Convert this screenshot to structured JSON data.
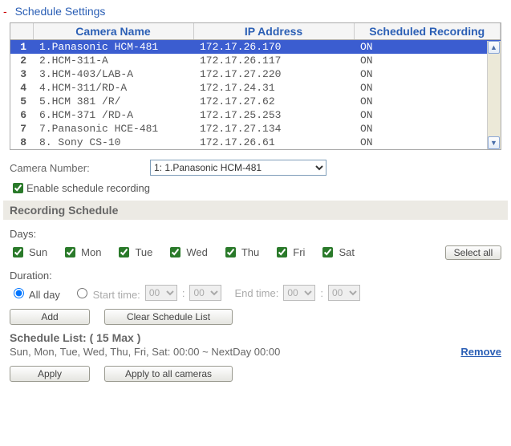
{
  "header": {
    "title": "Schedule Settings"
  },
  "table": {
    "columns": {
      "idx": "",
      "name": "Camera Name",
      "ip": "IP Address",
      "rec": "Scheduled Recording"
    },
    "rows": [
      {
        "idx": "1",
        "name": "1.Panasonic HCM-481",
        "ip": "172.17.26.170",
        "rec": "ON",
        "selected": true
      },
      {
        "idx": "2",
        "name": "2.HCM-311-A",
        "ip": "172.17.26.117",
        "rec": "ON"
      },
      {
        "idx": "3",
        "name": "3.HCM-403/LAB-A",
        "ip": "172.17.27.220",
        "rec": "ON"
      },
      {
        "idx": "4",
        "name": "4.HCM-311/RD-A",
        "ip": "172.17.24.31",
        "rec": "ON"
      },
      {
        "idx": "5",
        "name": "5.HCM 381 /R/",
        "ip": "172.17.27.62",
        "rec": "ON"
      },
      {
        "idx": "6",
        "name": "6.HCM-371 /RD-A",
        "ip": "172.17.25.253",
        "rec": "ON"
      },
      {
        "idx": "7",
        "name": "7.Panasonic HCE-481",
        "ip": "172.17.27.134",
        "rec": "ON"
      },
      {
        "idx": "8",
        "name": "8. Sony CS-10",
        "ip": "172.17.26.61",
        "rec": "ON"
      }
    ]
  },
  "camera_select": {
    "label": "Camera Number:",
    "value": "1: 1.Panasonic HCM-481"
  },
  "enable": {
    "checked": true,
    "label": "Enable schedule recording"
  },
  "recording_section": "Recording Schedule",
  "days": {
    "label": "Days:",
    "items": [
      {
        "label": "Sun",
        "checked": true
      },
      {
        "label": "Mon",
        "checked": true
      },
      {
        "label": "Tue",
        "checked": true
      },
      {
        "label": "Wed",
        "checked": true
      },
      {
        "label": "Thu",
        "checked": true
      },
      {
        "label": "Fri",
        "checked": true
      },
      {
        "label": "Sat",
        "checked": true
      }
    ],
    "select_all": "Select all"
  },
  "duration": {
    "label": "Duration:",
    "allday": "All day",
    "start": "Start time:",
    "end": "End time:",
    "hh": "00",
    "mm": "00",
    "mode": "allday"
  },
  "buttons": {
    "add": "Add",
    "clear": "Clear Schedule List",
    "apply": "Apply",
    "apply_all": "Apply to all cameras"
  },
  "schedule_list": {
    "title": "Schedule List: ( 15 Max )",
    "entry": "Sun, Mon, Tue, Wed, Thu, Fri, Sat: 00:00 ~ NextDay 00:00",
    "remove": "Remove"
  }
}
